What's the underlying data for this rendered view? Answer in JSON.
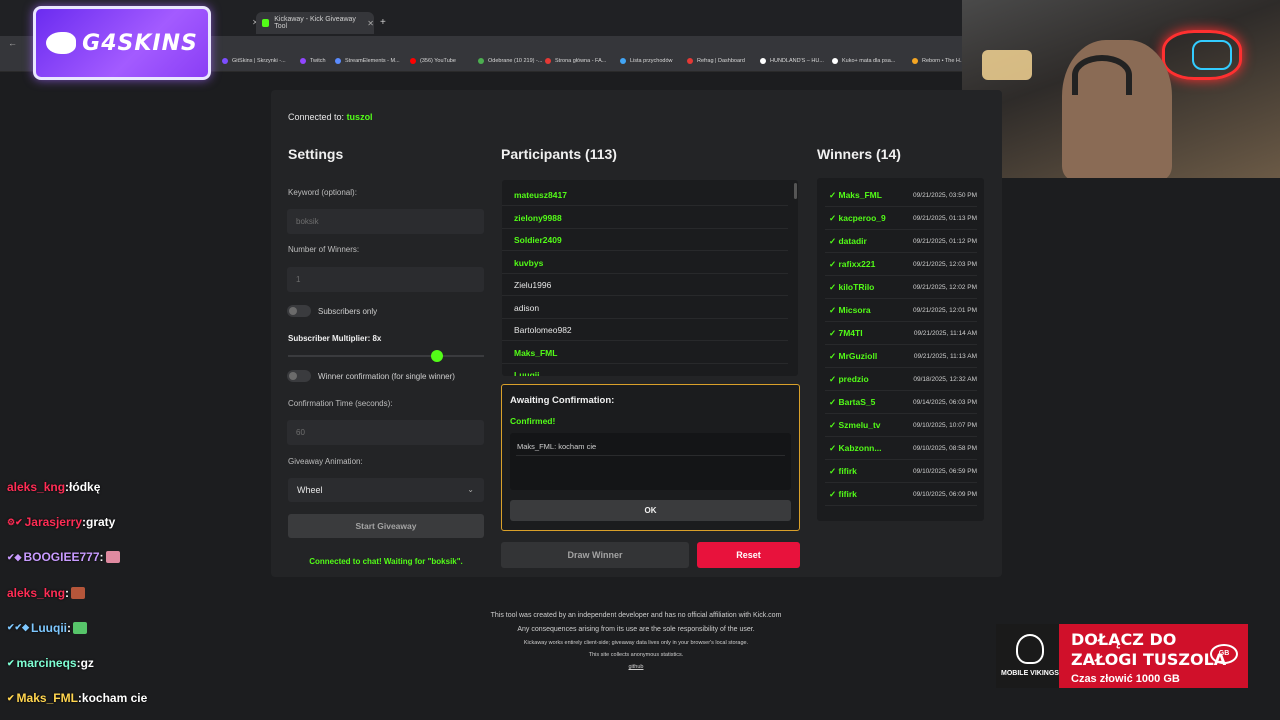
{
  "browser": {
    "active_tab": "Kickaway - Kick Giveaway Tool",
    "new_tab_icon": "plus-icon",
    "bookmarks": [
      {
        "label": "GitSkins | Skrzynki -...",
        "color": "#7c4dff"
      },
      {
        "label": "Twitch",
        "color": "#9146ff"
      },
      {
        "label": "StreamElements - M...",
        "color": "#5b8cff"
      },
      {
        "label": "(356) YouTube",
        "color": "#ff0000"
      },
      {
        "label": "Odebrane (10 219) -...",
        "color": "#4caf50"
      },
      {
        "label": "Strona główna - FA...",
        "color": "#e53935"
      },
      {
        "label": "Lista przychodów",
        "color": "#42a5f5"
      },
      {
        "label": "Refrag | Dashboard",
        "color": "#e53935"
      },
      {
        "label": "HUNDLAND'S – HU...",
        "color": "#ffffff"
      },
      {
        "label": "Kuko+ mata dla psa...",
        "color": "#ffffff"
      },
      {
        "label": "Reborn • The H...",
        "color": "#f5a623"
      }
    ]
  },
  "overlay": {
    "logo_text": "G4SKINS"
  },
  "app": {
    "connected_label": "Connected to:",
    "channel": "tuszol",
    "settings": {
      "title": "Settings",
      "keyword_label": "Keyword (optional):",
      "keyword_value": "boksik",
      "winners_label": "Number of Winners:",
      "winners_value": "1",
      "subscribers_only_label": "Subscribers only",
      "multiplier_label": "Subscriber Multiplier: 8x",
      "multiplier_value": 8,
      "confirmation_toggle_label": "Winner confirmation (for single winner)",
      "confirmation_time_label": "Confirmation Time (seconds):",
      "confirmation_time_value": "60",
      "animation_label": "Giveaway Animation:",
      "animation_value": "Wheel",
      "start_button": "Start Giveaway",
      "status": "Connected to chat! Waiting for \"boksik\"."
    },
    "participants": {
      "title": "Participants (113)",
      "items": [
        {
          "name": "mateusz8417",
          "sub": true
        },
        {
          "name": "zielony9988",
          "sub": true
        },
        {
          "name": "Soldier2409",
          "sub": true
        },
        {
          "name": "kuvbys",
          "sub": true
        },
        {
          "name": "Zielu1996",
          "sub": false
        },
        {
          "name": "adison",
          "sub": false
        },
        {
          "name": "Bartolomeo982",
          "sub": false
        },
        {
          "name": "Maks_FML",
          "sub": true
        },
        {
          "name": "Luuqii",
          "sub": true
        }
      ]
    },
    "confirmation": {
      "title": "Awaiting Confirmation:",
      "status": "Confirmed!",
      "message": "Maks_FML: kocham cie",
      "ok_button": "OK"
    },
    "draw_button": "Draw Winner",
    "reset_button": "Reset",
    "winners": {
      "title": "Winners (14)",
      "items": [
        {
          "name": "Maks_FML",
          "date": "09/21/2025, 03:50 PM"
        },
        {
          "name": "kacperoo_9",
          "date": "09/21/2025, 01:13 PM"
        },
        {
          "name": "datadir",
          "date": "09/21/2025, 01:12 PM"
        },
        {
          "name": "rafixx221",
          "date": "09/21/2025, 12:03 PM"
        },
        {
          "name": "kiloTRilo",
          "date": "09/21/2025, 12:02 PM"
        },
        {
          "name": "Micsora",
          "date": "09/21/2025, 12:01 PM"
        },
        {
          "name": "7M4TI",
          "date": "09/21/2025, 11:14 AM"
        },
        {
          "name": "MrGuzioll",
          "date": "09/21/2025, 11:13 AM"
        },
        {
          "name": "predzio",
          "date": "09/18/2025, 12:32 AM"
        },
        {
          "name": "BartaS_5",
          "date": "09/14/2025, 06:03 PM"
        },
        {
          "name": "Szmelu_tv",
          "date": "09/10/2025, 10:07 PM"
        },
        {
          "name": "Kabzonn...",
          "date": "09/10/2025, 08:58 PM"
        },
        {
          "name": "fifirk",
          "date": "09/10/2025, 06:59 PM"
        },
        {
          "name": "fifirk",
          "date": "09/10/2025, 06:09 PM"
        }
      ]
    },
    "footer": {
      "line1": "This tool was created by an independent developer and has no official affiliation with Kick.com",
      "line2": "Any consequences arising from its use are the sole responsibility of the user.",
      "line3": "Kickaway works entirely client-side; giveaway data lives only in your browser's local storage.",
      "line4": "This site collects anonymous statistics.",
      "link": "github"
    }
  },
  "chat": [
    {
      "user": "aleks_kng",
      "color": "#ff2d55",
      "badge": "",
      "text": "łódkę",
      "emote": ""
    },
    {
      "user": "Jarasjerry",
      "color": "#ff2d55",
      "badge": "⚙✔",
      "text": "graty",
      "emote": ""
    },
    {
      "user": "BOOGIEE777",
      "color": "#c89bff",
      "badge": "✔◆",
      "text": "",
      "emote": "#e08aa0"
    },
    {
      "user": "aleks_kng",
      "color": "#ff2d55",
      "badge": "",
      "text": "",
      "emote": "#b5563a"
    },
    {
      "user": "Luuqii",
      "color": "#7ec8ff",
      "badge": "✔✔◆",
      "text": "",
      "emote": "#57c56a"
    },
    {
      "user": "marcineqs",
      "color": "#7fffd4",
      "badge": "✔",
      "text": "gz",
      "emote": ""
    },
    {
      "user": "Maks_FML",
      "color": "#ffd54f",
      "badge": "✔",
      "text": "kocham cie",
      "emote": ""
    }
  ],
  "ad": {
    "line1": "DOŁĄCZ DO",
    "line2": "ZAŁOGI TUSZOLA",
    "line3": "Czas złowić 1000 GB",
    "brand": "MOBILE VIKINGS",
    "badge": "GB"
  }
}
